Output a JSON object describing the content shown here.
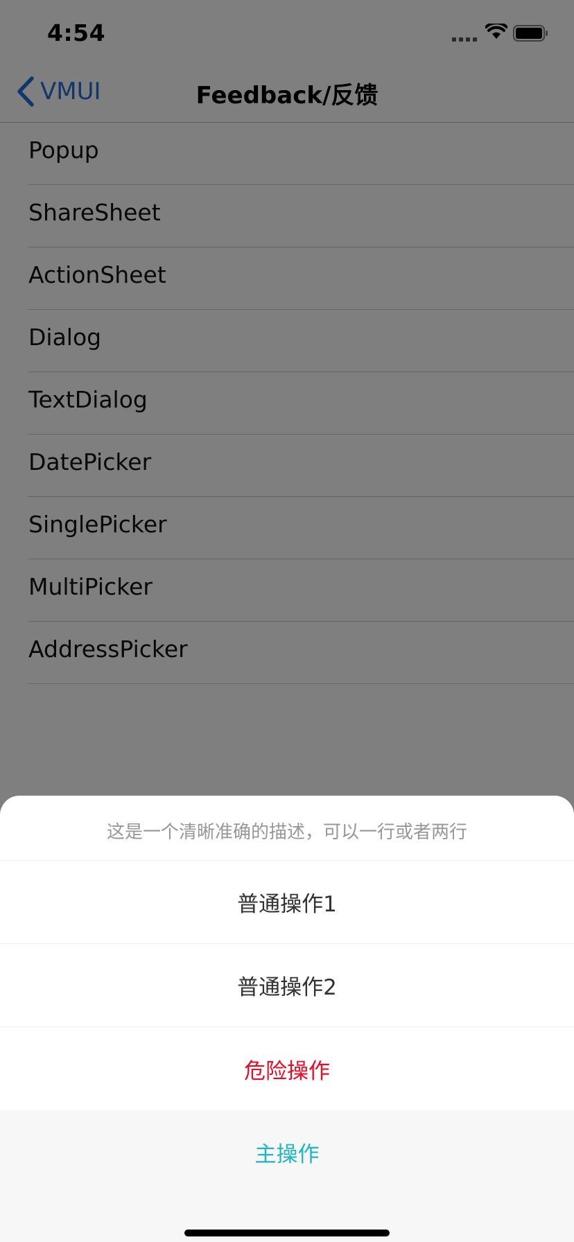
{
  "status_bar": {
    "time": "4:54"
  },
  "nav": {
    "back_label": "VMUI",
    "title": "Feedback/反馈"
  },
  "list": {
    "items": [
      {
        "label": "Popup"
      },
      {
        "label": "ShareSheet"
      },
      {
        "label": "ActionSheet"
      },
      {
        "label": "Dialog"
      },
      {
        "label": "TextDialog"
      },
      {
        "label": "DatePicker"
      },
      {
        "label": "SinglePicker"
      },
      {
        "label": "MultiPicker"
      },
      {
        "label": "AddressPicker"
      }
    ]
  },
  "action_sheet": {
    "description": "这是一个清晰准确的描述，可以一行或者两行",
    "actions": [
      {
        "label": "普通操作1",
        "kind": "normal"
      },
      {
        "label": "普通操作2",
        "kind": "normal"
      },
      {
        "label": "危险操作",
        "kind": "danger"
      },
      {
        "label": "主操作",
        "kind": "primary"
      }
    ]
  },
  "colors": {
    "accent": "#1f6fd6",
    "danger": "#ee0a24",
    "primary": "#1fb6c3",
    "overlay": "#808080"
  },
  "icons": {
    "back": "chevron-left-icon",
    "signal": "cellular-signal-icon",
    "wifi": "wifi-icon",
    "battery": "battery-icon"
  }
}
